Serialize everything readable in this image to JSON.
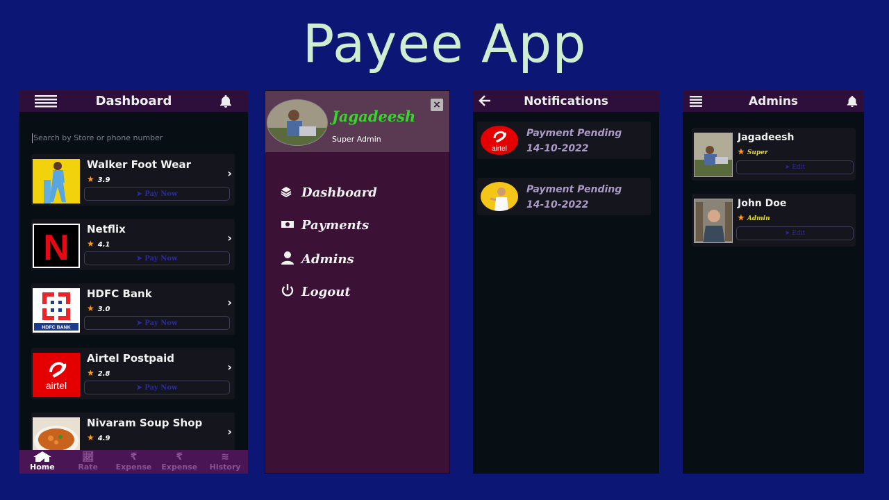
{
  "title": "Payee App",
  "colors": {
    "background": "#0b1675",
    "title": "#cdeed0",
    "topbar": "#2e0e3a",
    "drawer": "#3b1236",
    "accent_green": "#37d42e",
    "star": "#ff9a1a"
  },
  "dashboard": {
    "title": "Dashboard",
    "menu_icon": "hamburger-icon",
    "bell_icon": "bell-icon",
    "search_placeholder": "Search by Store or phone number",
    "pay_now_label": "Pay Now",
    "stores": [
      {
        "name": "Walker Foot Wear",
        "rating": "3.9"
      },
      {
        "name": "Netflix",
        "rating": "4.1"
      },
      {
        "name": "HDFC Bank",
        "rating": "3.0"
      },
      {
        "name": "Airtel Postpaid",
        "rating": "2.8"
      },
      {
        "name": "Nivaram Soup Shop",
        "rating": "4.9"
      }
    ],
    "nav": [
      {
        "label": "Home",
        "icon": "home-icon"
      },
      {
        "label": "Rate",
        "icon": "chart-icon"
      },
      {
        "label": "Expense",
        "icon": "rupee-icon"
      },
      {
        "label": "Expense",
        "icon": "rupee-icon"
      },
      {
        "label": "History",
        "icon": "layers-icon"
      }
    ]
  },
  "drawer": {
    "user_name": "Jagadeesh",
    "user_role": "Super Admin",
    "items": [
      {
        "label": "Dashboard",
        "icon": "layers-icon"
      },
      {
        "label": "Payments",
        "icon": "money-icon"
      },
      {
        "label": "Admins",
        "icon": "user-icon"
      },
      {
        "label": "Logout",
        "icon": "power-icon"
      }
    ]
  },
  "notifications": {
    "title": "Notifications",
    "items": [
      {
        "title": "Payment Pending",
        "date": "14-10-2022",
        "logo_text": "airtel"
      },
      {
        "title": "Payment Pending",
        "date": "14-10-2022"
      }
    ]
  },
  "admins": {
    "title": "Admins",
    "edit_label": "Edit",
    "items": [
      {
        "name": "Jagadeesh",
        "role": "Super"
      },
      {
        "name": "John Doe",
        "role": "Admin"
      }
    ]
  },
  "logos": {
    "netflix": "N",
    "hdfc": "HDFC BANK",
    "airtel": "airtel"
  }
}
